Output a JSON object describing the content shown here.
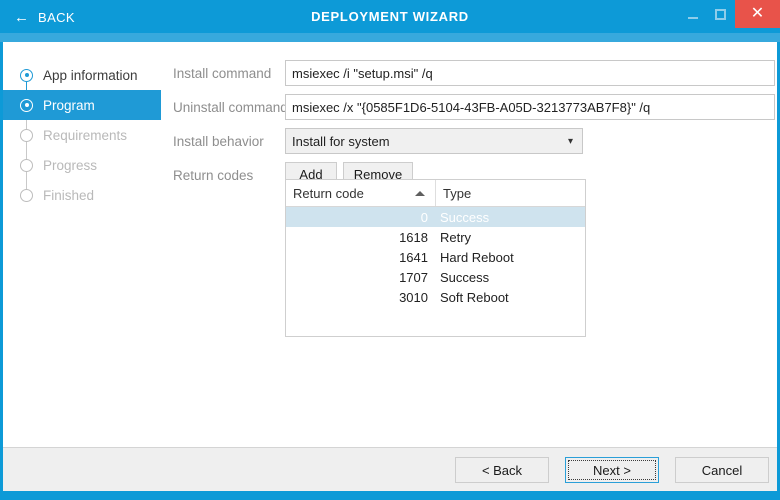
{
  "titlebar": {
    "back_label": "BACK",
    "back_icon": "arrow-left-icon",
    "title": "DEPLOYMENT WIZARD",
    "minimize_icon": "minimize-icon",
    "maximize_icon": "maximize-icon",
    "close_icon": "close-icon",
    "close_label": "✕",
    "bg_color": "#0d9ad7",
    "accent_color": "#37a9dd",
    "close_color": "#e8534a"
  },
  "sidebar": {
    "steps": [
      {
        "label": "App information",
        "state": "done"
      },
      {
        "label": "Program",
        "state": "current"
      },
      {
        "label": "Requirements",
        "state": "pending"
      },
      {
        "label": "Progress",
        "state": "pending"
      },
      {
        "label": "Finished",
        "state": "pending"
      }
    ]
  },
  "form": {
    "install_command": {
      "label": "Install command",
      "value": "msiexec /i \"setup.msi\" /q",
      "placeholder": ""
    },
    "uninstall_command": {
      "label": "Uninstall command",
      "value": "msiexec /x \"{0585F1D6-5104-43FB-A05D-3213773AB7F8}\" /q",
      "placeholder": ""
    },
    "install_behavior": {
      "label": "Install behavior",
      "value": "Install for system",
      "chevron_icon": "chevron-down-icon",
      "chevron": "▾",
      "options": [
        "Install for system"
      ]
    },
    "return_codes": {
      "label": "Return codes",
      "add_label": "Add",
      "remove_label": "Remove"
    }
  },
  "return_codes_table": {
    "columns": [
      {
        "key": "code",
        "label": "Return code",
        "sort": "ascending",
        "sort_icon": "sort-ascending-icon"
      },
      {
        "key": "type",
        "label": "Type"
      }
    ],
    "rows": [
      {
        "code": "0",
        "type": "Success",
        "selected": true
      },
      {
        "code": "1618",
        "type": "Retry",
        "selected": false
      },
      {
        "code": "1641",
        "type": "Hard Reboot",
        "selected": false
      },
      {
        "code": "1707",
        "type": "Success",
        "selected": false
      },
      {
        "code": "3010",
        "type": "Soft Reboot",
        "selected": false
      }
    ],
    "selected_row_color": "#cfe3ee"
  },
  "footer": {
    "back_label": "< Back",
    "next_label": "Next >",
    "cancel_label": "Cancel",
    "focused_button": "Next >"
  }
}
